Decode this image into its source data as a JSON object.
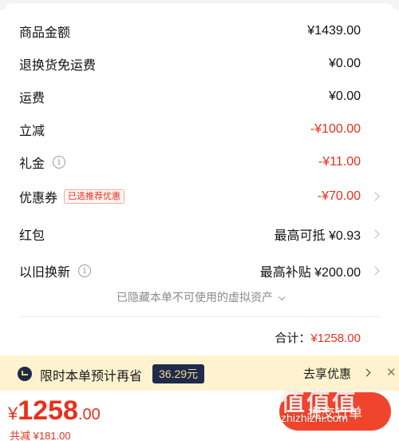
{
  "rows": [
    {
      "label": "商品金额",
      "value": "¥1439.00"
    },
    {
      "label": "退换货免运费",
      "value": "¥0.00"
    },
    {
      "label": "运费",
      "value": "¥0.00"
    },
    {
      "label": "立减",
      "value": "-¥100.00"
    },
    {
      "label": "礼金",
      "value": "-¥11.00"
    },
    {
      "label": "优惠券",
      "tag": "已选推荐优惠",
      "value": "-¥70.00"
    },
    {
      "label": "红包",
      "value": "最高可抵 ¥0.93"
    },
    {
      "label": "以旧换新",
      "value": "最高补贴 ¥200.00"
    }
  ],
  "hidden_note": "已隐藏本单不可使用的虚拟资产",
  "total": {
    "label": "合计：",
    "amount": "¥1258.00"
  },
  "promo": {
    "text": "限时本单预计再省",
    "badge": "36.29元",
    "share": "去享优惠",
    "close": "✕"
  },
  "bottom": {
    "yen": "¥",
    "price_int": "1258",
    "price_dec": ".00",
    "saved": "共减 ¥181.00",
    "submit": "提交订单"
  },
  "watermark": {
    "text": "值值值",
    "url": "zhizhizhi.com"
  },
  "colors": {
    "accent": "#e8301c",
    "button": "#f0452c",
    "promo_bg": "#fff3cf",
    "badge_bg": "#1e2b4d"
  }
}
